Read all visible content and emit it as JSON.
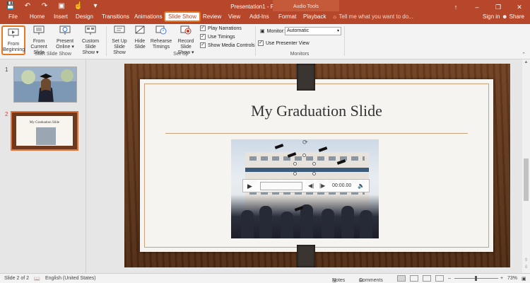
{
  "window": {
    "title": "Presentation1 - PowerPoint",
    "context_tab": "Audio Tools",
    "controls": [
      "↑",
      "–",
      "❐",
      "✕"
    ]
  },
  "tabs": [
    {
      "label": "File"
    },
    {
      "label": "Home"
    },
    {
      "label": "Insert"
    },
    {
      "label": "Design"
    },
    {
      "label": "Transitions"
    },
    {
      "label": "Animations"
    },
    {
      "label": "Slide Show",
      "active": true
    },
    {
      "label": "Review"
    },
    {
      "label": "View"
    },
    {
      "label": "Add-Ins"
    },
    {
      "label": "Format"
    },
    {
      "label": "Playback"
    }
  ],
  "tell_me": "Tell me what you want to do...",
  "sign_in": "Sign in",
  "share": "Share",
  "ribbon": {
    "from_beginning": "From\nBeginning",
    "from_current": "From\nCurrent Slide",
    "present_online": "Present\nOnline ▾",
    "custom_show": "Custom Slide\nShow ▾",
    "group_start": "Start Slide Show",
    "setup_show": "Set Up\nSlide Show",
    "hide_slide": "Hide\nSlide",
    "rehearse": "Rehearse\nTimings",
    "record": "Record Slide\nShow ▾",
    "group_setup": "Set Up",
    "play_narrations": "Play Narrations",
    "use_timings": "Use Timings",
    "show_media": "Show Media Controls",
    "monitor_label": "Monitor:",
    "monitor_value": "Automatic",
    "presenter_view": "Use Presenter View",
    "group_monitors": "Monitors"
  },
  "thumbnails": {
    "n1": "1",
    "n2": "2",
    "slide2_title": "My Graduation Slide"
  },
  "slide": {
    "title": "My Graduation Slide",
    "audio_time": "00:00.00"
  },
  "status": {
    "slide_of": "Slide 2 of 2",
    "language": "English (United States)",
    "notes": "Notes",
    "comments": "Comments",
    "zoom": "73%"
  },
  "colors": {
    "accent": "#b7472a",
    "highlight": "#e87722"
  }
}
